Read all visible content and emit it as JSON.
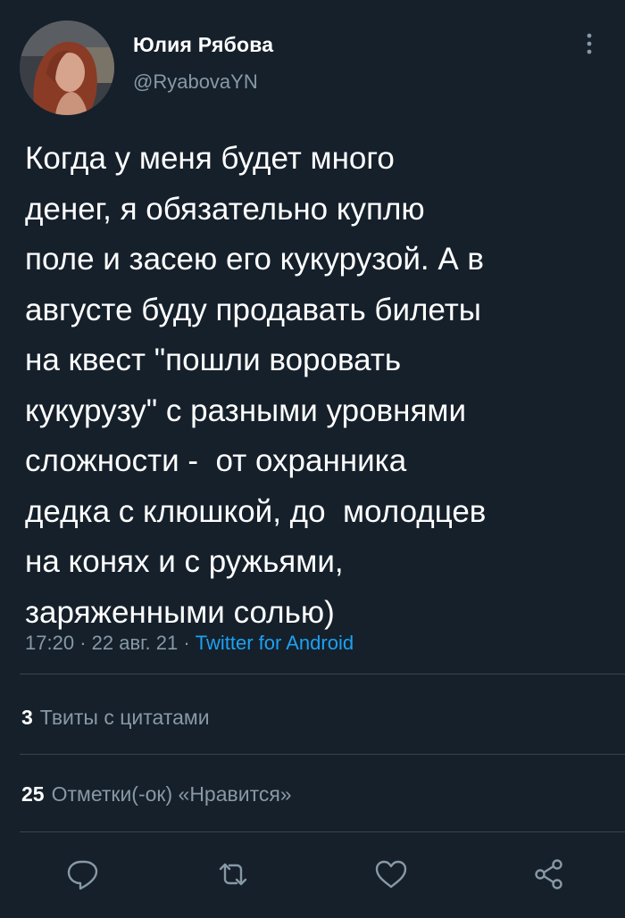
{
  "user": {
    "display_name": "Юлия Рябова",
    "username": "@RyabovaYN",
    "avatar_icon": "profile-photo"
  },
  "tweet": {
    "text": "Когда у меня будет много\nденег, я обязательно куплю\nполе и засею его кукурузой. А в\nавгусте буду продавать билеты\nна квест \"пошли воровать\nкукурузу\" с разными уровнями\nсложности -  от охранника\nдедка с клюшкой, до  молодцев\nна конях и с ружьями,\nзаряженными солью)",
    "time": "17:20",
    "date": "22 авг. 21",
    "separator": "·",
    "source": "Twitter for Android"
  },
  "stats": {
    "quotes": {
      "count": "3",
      "label": "Твиты с цитатами"
    },
    "likes": {
      "count": "25",
      "label": "Отметки(-ок) «Нравится»"
    }
  },
  "actions": {
    "icons": [
      "reply-icon",
      "retweet-icon",
      "like-icon",
      "share-icon"
    ]
  },
  "colors": {
    "background": "#15202b",
    "primary_text": "#ffffff",
    "secondary_text": "#8899a6",
    "accent": "#1da1f2",
    "divider": "#38444d"
  }
}
